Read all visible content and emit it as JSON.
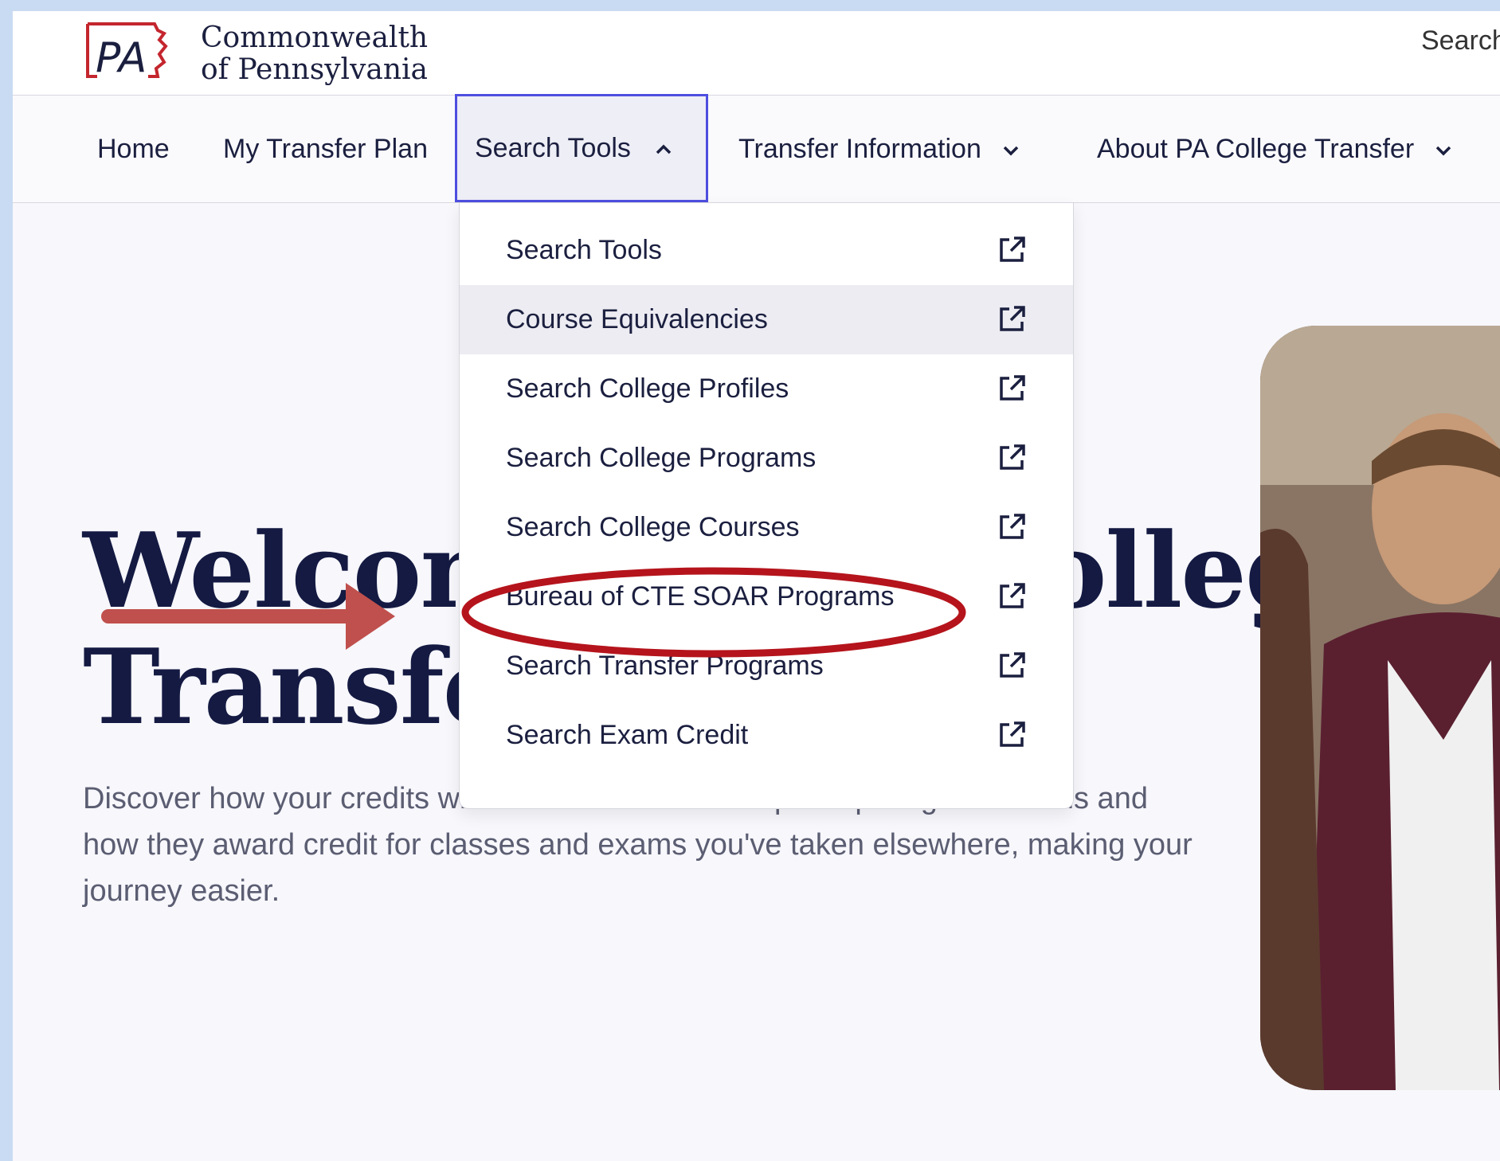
{
  "logo": {
    "mark_text": "PA",
    "line1": "Commonwealth",
    "line2": "of Pennsylvania"
  },
  "header": {
    "search_label": "Search"
  },
  "nav": {
    "items": [
      {
        "label": "Home"
      },
      {
        "label": "My Transfer Plan"
      },
      {
        "label": "Search Tools",
        "expanded": true
      },
      {
        "label": "Transfer Information"
      },
      {
        "label": "About PA College Transfer"
      }
    ]
  },
  "dropdown": {
    "items": [
      {
        "label": "Search Tools",
        "icon": "external-link-icon"
      },
      {
        "label": "Course Equivalencies",
        "icon": "external-link-icon"
      },
      {
        "label": "Search College Profiles",
        "icon": "external-link-icon"
      },
      {
        "label": "Search College Programs",
        "icon": "external-link-icon"
      },
      {
        "label": "Search College Courses",
        "icon": "external-link-icon"
      },
      {
        "label": "Bureau of CTE SOAR Programs",
        "icon": "external-link-icon"
      },
      {
        "label": "Search Transfer Programs",
        "icon": "external-link-icon"
      },
      {
        "label": "Search Exam Credit",
        "icon": "external-link-icon"
      }
    ]
  },
  "hero": {
    "title_line1": "Welcome to PA College",
    "title_line2": "Transfer",
    "description": "Discover how your credits will transfer between our participating institutions and how they award credit for classes and exams you've taken elsewhere, making your journey easier."
  },
  "colors": {
    "navy": "#141a42",
    "focus_border": "#4e4ee0",
    "annotation_red": "#b5141c",
    "arrow_red": "#c0504d"
  }
}
